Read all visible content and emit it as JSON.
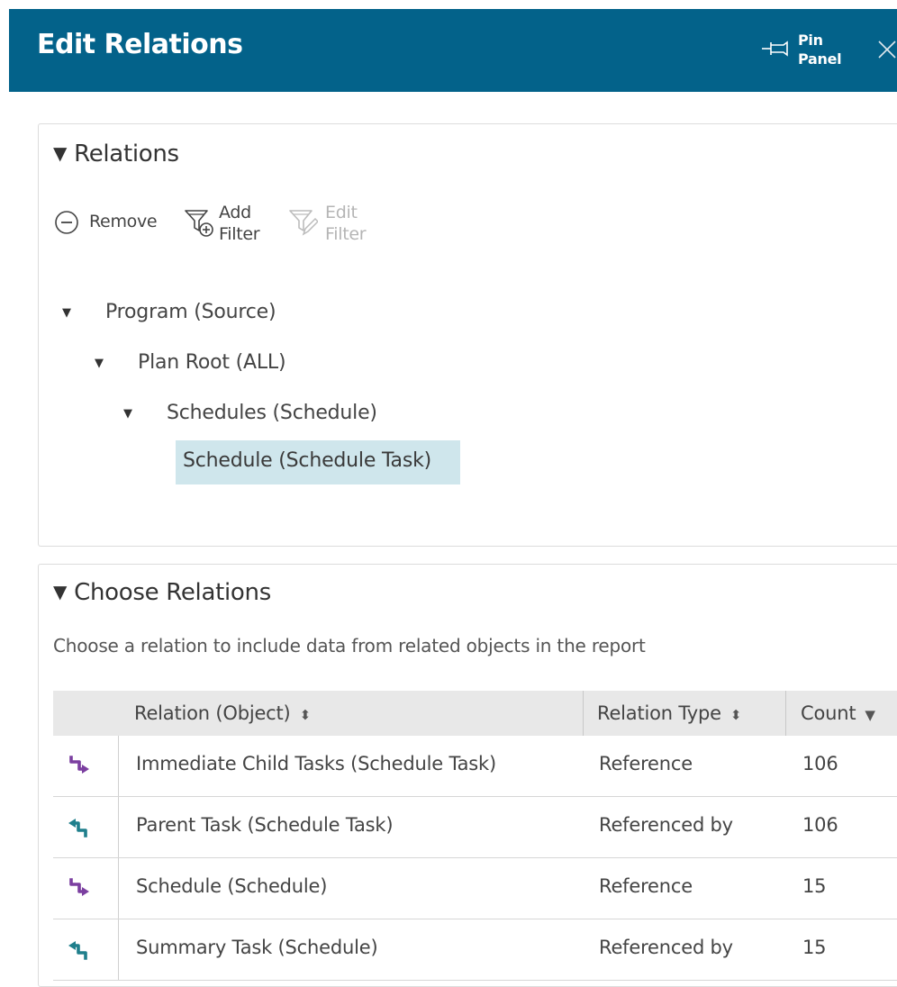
{
  "header": {
    "title": "Edit Relations",
    "pin_label": "Pin Panel",
    "pin_icon": "pin-icon",
    "close_icon": "close-icon",
    "background": "#03628a"
  },
  "relations": {
    "title": "Relations",
    "toolbar": {
      "remove_label": "Remove",
      "add_filter_label": "Add Filter",
      "edit_filter_label": "Edit Filter"
    },
    "tree": [
      {
        "label": "Program (Source)",
        "expanded": true
      },
      {
        "label": "Plan Root (ALL)",
        "expanded": true
      },
      {
        "label": "Schedules (Schedule)",
        "expanded": true
      },
      {
        "label": "Schedule (Schedule Task)",
        "selected": true
      }
    ],
    "selected_color": "#cfe6ec"
  },
  "choose": {
    "title": "Choose Relations",
    "hint": "Choose a relation to include data from related objects in the report",
    "columns": [
      "Relation (Object)",
      "Relation Type",
      "Count"
    ],
    "rows": [
      {
        "icon": "reference-arrow-icon",
        "relation": "Immediate Child Tasks (Schedule Task)",
        "type": "Reference",
        "count": "106"
      },
      {
        "icon": "referenced-by-arrow-icon",
        "relation": "Parent Task (Schedule Task)",
        "type": "Referenced by",
        "count": "106"
      },
      {
        "icon": "reference-arrow-icon",
        "relation": "Schedule (Schedule)",
        "type": "Reference",
        "count": "15"
      },
      {
        "icon": "referenced-by-arrow-icon",
        "relation": "Summary Task (Schedule)",
        "type": "Referenced by",
        "count": "15"
      }
    ],
    "reference_color": "#7b3fa0",
    "referenced_by_color": "#1f7f8c"
  }
}
